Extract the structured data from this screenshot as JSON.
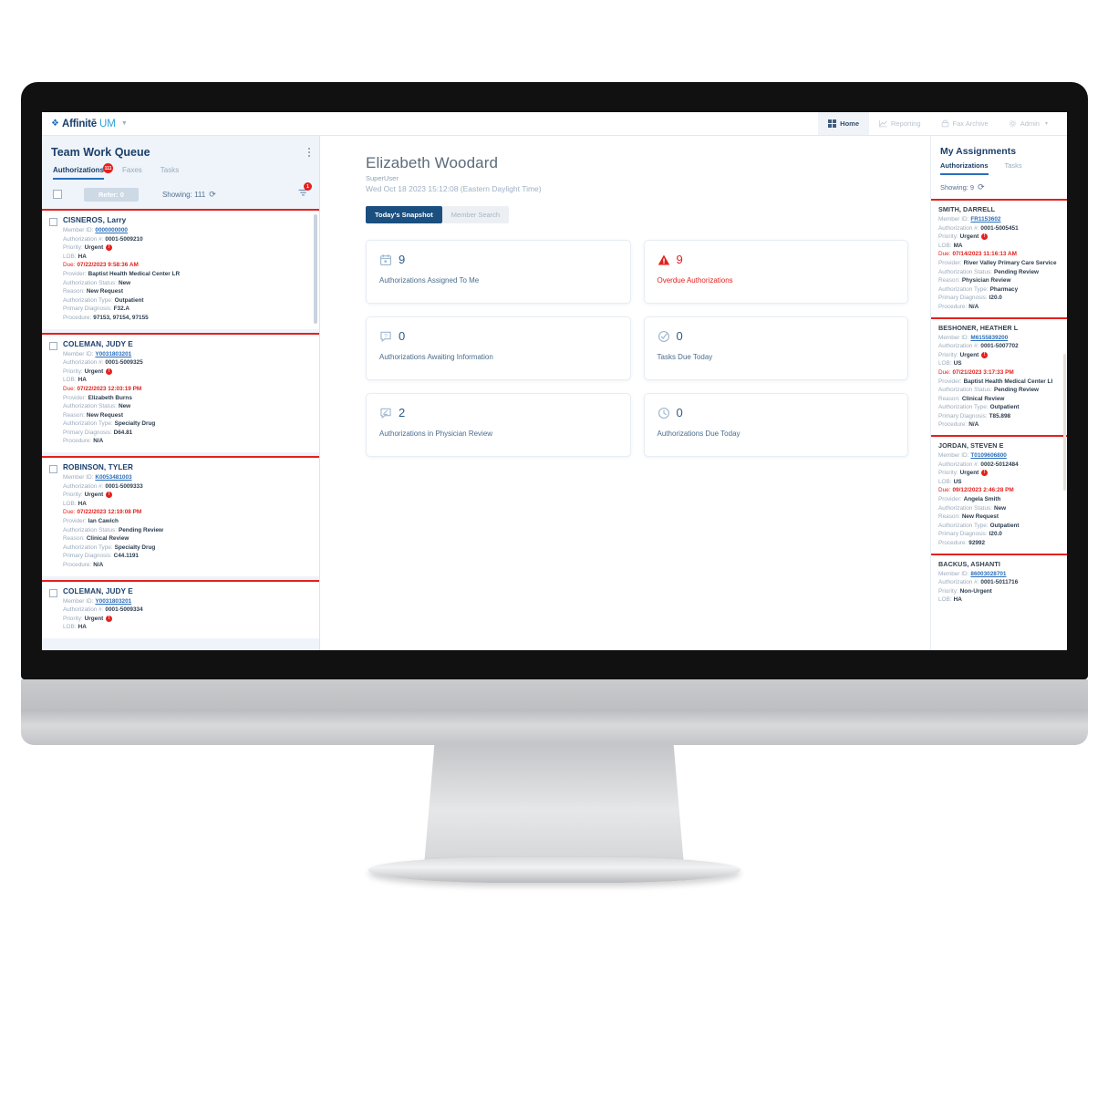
{
  "appbar": {
    "brand_name": "Affinitē",
    "brand_suffix": "UM",
    "brand_mark_icon": "affinite-logo-icon",
    "nav": [
      {
        "label": "Home",
        "icon": "home-grid-icon",
        "active": true
      },
      {
        "label": "Reporting",
        "icon": "reporting-chart-icon",
        "active": false
      },
      {
        "label": "Fax Archive",
        "icon": "fax-archive-icon",
        "active": false
      },
      {
        "label": "Admin",
        "icon": "gear-icon",
        "active": false,
        "caret": "▾"
      }
    ]
  },
  "left_panel": {
    "title": "Team Work Queue",
    "kebab_icon": "more-vertical-icon",
    "tabs": [
      {
        "label": "Authorizations",
        "active": true,
        "badge": "111"
      },
      {
        "label": "Faxes",
        "active": false
      },
      {
        "label": "Tasks",
        "active": false
      }
    ],
    "toolbar": {
      "select_all_checkbox": "",
      "refer_label": "Refer: 0",
      "showing_label": "Showing: 111",
      "refresh_icon": "refresh-icon",
      "filter_icon": "filter-icon",
      "filter_badge": "1"
    },
    "field_labels": {
      "member_id": "Member ID:",
      "authorization_no": "Authorization #:",
      "priority": "Priority:",
      "lob": "LOB:",
      "due": "Due:",
      "provider": "Provider:",
      "authorization_status": "Authorization Status:",
      "reason": "Reason:",
      "authorization_type": "Authorization Type:",
      "primary_diagnosis": "Primary Diagnosis:",
      "procedure": "Procedure:"
    },
    "items": [
      {
        "name": "CISNEROS, Larry",
        "member_id": "0000000000",
        "authorization_no": "0001-5009210",
        "priority": "Urgent",
        "lob": "HA",
        "due": "07/22/2023 9:58:36 AM",
        "provider": "Baptist Health Medical Center LR",
        "authorization_status": "New",
        "reason": "New Request",
        "authorization_type": "Outpatient",
        "primary_diagnosis": "F32.A",
        "procedure": "97153,  97154,  97155"
      },
      {
        "name": "COLEMAN, JUDY E",
        "member_id": "Y0031803201",
        "authorization_no": "0001-5009325",
        "priority": "Urgent",
        "lob": "HA",
        "due": "07/22/2023 12:03:19 PM",
        "provider": "Elizabeth Burns",
        "authorization_status": "New",
        "reason": "New Request",
        "authorization_type": "Specialty Drug",
        "primary_diagnosis": "D64.81",
        "procedure": "N/A"
      },
      {
        "name": "ROBINSON, TYLER",
        "member_id": "K0053481003",
        "authorization_no": "0001-5009333",
        "priority": "Urgent",
        "lob": "HA",
        "due": "07/22/2023 12:19:08 PM",
        "provider": "Ian Cawich",
        "authorization_status": "Pending Review",
        "reason": "Clinical Review",
        "authorization_type": "Specialty Drug",
        "primary_diagnosis": "C44.1191",
        "procedure": "N/A"
      },
      {
        "name": "COLEMAN, JUDY E",
        "member_id": "Y0031803201",
        "authorization_no": "0001-5009334",
        "priority": "Urgent",
        "lob": "HA"
      }
    ]
  },
  "center_panel": {
    "user_name": "Elizabeth Woodard",
    "user_role": "SuperUser",
    "timestamp": "Wed Oct 18 2023 15:12:08 (Eastern Daylight Time)",
    "segments": [
      {
        "label": "Today's Snapshot",
        "active": true
      },
      {
        "label": "Member Search",
        "active": false
      }
    ],
    "stat_cards": [
      {
        "value": "9",
        "label": "Authorizations Assigned To Me",
        "icon": "calendar-icon",
        "alert": false
      },
      {
        "value": "9",
        "label": "Overdue Authorizations",
        "icon": "warning-triangle-icon",
        "alert": true
      },
      {
        "value": "0",
        "label": "Authorizations Awaiting Information",
        "icon": "question-chat-icon",
        "alert": false
      },
      {
        "value": "0",
        "label": "Tasks Due Today",
        "icon": "check-circle-icon",
        "alert": false
      },
      {
        "value": "2",
        "label": "Authorizations in Physician Review",
        "icon": "physician-review-icon",
        "alert": false
      },
      {
        "value": "0",
        "label": "Authorizations Due Today",
        "icon": "clock-icon",
        "alert": false
      }
    ]
  },
  "right_panel": {
    "title": "My Assignments",
    "tabs": [
      {
        "label": "Authorizations",
        "active": true
      },
      {
        "label": "Tasks",
        "active": false
      }
    ],
    "showing_label": "Showing: 9",
    "refresh_icon": "refresh-icon",
    "items": [
      {
        "name": "SMITH, DARRELL",
        "member_id": "FR1153602",
        "authorization_no": "0001-5005451",
        "priority": "Urgent",
        "lob": "MA",
        "due": "07/14/2023 11:16:13 AM",
        "provider": "River Valley Primary Care Service",
        "authorization_status": "Pending Review",
        "reason": "Physician Review",
        "authorization_type": "Pharmacy",
        "primary_diagnosis": "I20.0",
        "procedure": "N/A"
      },
      {
        "name": "BESHONER, HEATHER L",
        "member_id": "M6155839200",
        "authorization_no": "0001-5007702",
        "priority": "Urgent",
        "lob": "US",
        "due": "07/21/2023 3:17:33 PM",
        "provider": "Baptist Health Medical Center LI",
        "authorization_status": "Pending Review",
        "reason": "Clinical Review",
        "authorization_type": "Outpatient",
        "primary_diagnosis": "T85.898",
        "procedure": "N/A"
      },
      {
        "name": "JORDAN, STEVEN E",
        "member_id": "T0109606800",
        "authorization_no": "0002-5012484",
        "priority": "Urgent",
        "lob": "US",
        "due": "09/12/2023 2:46:28 PM",
        "provider": "Angela Smith",
        "authorization_status": "New",
        "reason": "New Request",
        "authorization_type": "Outpatient",
        "primary_diagnosis": "I20.0",
        "procedure": "92992"
      },
      {
        "name": "BACKUS, ASHANTI",
        "member_id": "86003028701",
        "authorization_no": "0001-5011716",
        "priority": "Non-Urgent",
        "lob": "HA"
      }
    ]
  },
  "colors": {
    "brand_blue": "#1b3f6b",
    "accent_blue": "#2a6ebb",
    "alert_red": "#e3211e",
    "panel_bg": "#eef4fa"
  }
}
